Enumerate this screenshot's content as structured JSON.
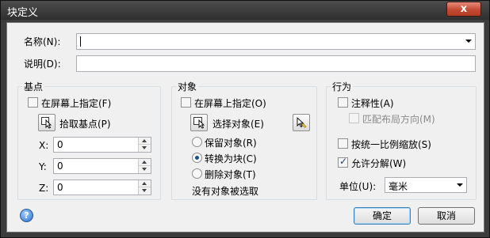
{
  "window": {
    "title": "块定义",
    "close_glyph": "x"
  },
  "name_field": {
    "label": "名称(N):",
    "value": ""
  },
  "description_field": {
    "label": "说明(D):",
    "value": ""
  },
  "base_point": {
    "title": "基点",
    "specify_onscreen": {
      "label": "在屏幕上指定(F)",
      "checked": false
    },
    "pick_button_label": "拾取基点(P)",
    "x": {
      "label": "X:",
      "value": "0"
    },
    "y": {
      "label": "Y:",
      "value": "0"
    },
    "z": {
      "label": "Z:",
      "value": "0"
    }
  },
  "objects": {
    "title": "对象",
    "specify_onscreen": {
      "label": "在屏幕上指定(O)",
      "checked": false
    },
    "select_button_label": "选择对象(E)",
    "options": [
      {
        "label": "保留对象(R)",
        "selected": false
      },
      {
        "label": "转换为块(C)",
        "selected": true
      },
      {
        "label": "删除对象(T)",
        "selected": false
      }
    ],
    "status": "没有对象被选取"
  },
  "behavior": {
    "title": "行为",
    "annotative": {
      "label": "注释性(A)",
      "checked": false
    },
    "match_orientation": {
      "label": "匹配布局方向(M)",
      "checked": false,
      "enabled": false
    },
    "scale_uniformly": {
      "label": "按统一比例缩放(S)",
      "checked": false
    },
    "allow_exploding": {
      "label": "允许分解(W)",
      "checked": true
    },
    "units": {
      "label": "单位(U):",
      "value": "毫米"
    }
  },
  "footer": {
    "help_glyph": "?",
    "ok_label": "确定",
    "cancel_label": "取消"
  },
  "colors": {
    "accent": "#3c7fb1",
    "title_bar": "#3a3a3a",
    "close_button": "#c44b33"
  }
}
